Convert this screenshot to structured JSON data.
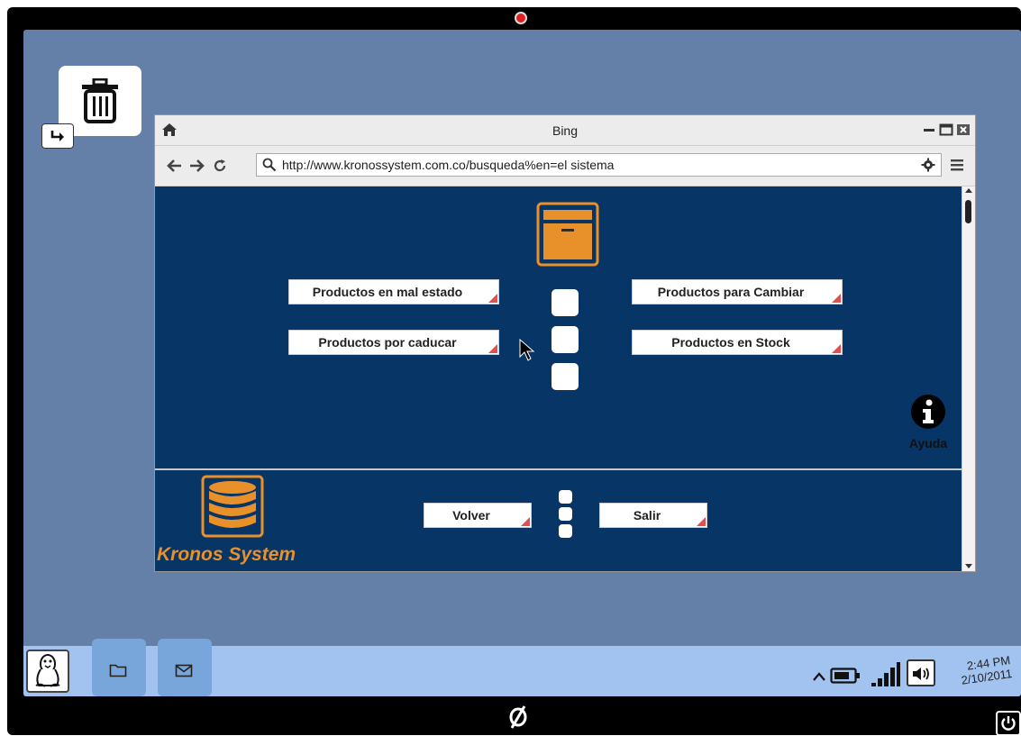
{
  "window": {
    "title": "Bing",
    "url": "http://www.kronossystem.com.co/busqueda%en=el sistema"
  },
  "menu": {
    "left_buttons": [
      "Productos en mal estado",
      "Productos por caducar"
    ],
    "right_buttons": [
      "Productos para Cambiar",
      "Productos en Stock"
    ]
  },
  "help": {
    "label": "Ayuda"
  },
  "footer": {
    "brand": "Kronos System",
    "back_label": "Volver",
    "exit_label": "Salir"
  },
  "clock": {
    "time": "2:44 PM",
    "date": "2/10/2011"
  },
  "colors": {
    "desktop": "#6580a8",
    "page_background": "#073566",
    "accent_orange": "#e8902a",
    "taskbar": "#a2c3f0"
  },
  "icons": [
    "trash-icon",
    "shortcut-arrow-icon",
    "home-icon",
    "minimize-icon",
    "maximize-icon",
    "close-icon",
    "back-arrow-icon",
    "forward-arrow-icon",
    "reload-icon",
    "search-icon",
    "gear-icon",
    "menu-icon",
    "archive-box-icon",
    "info-icon",
    "database-icon",
    "cursor-icon",
    "tux-icon",
    "folder-icon",
    "mail-icon",
    "chevron-up-icon",
    "battery-icon",
    "signal-icon",
    "speaker-icon",
    "power-icon"
  ]
}
